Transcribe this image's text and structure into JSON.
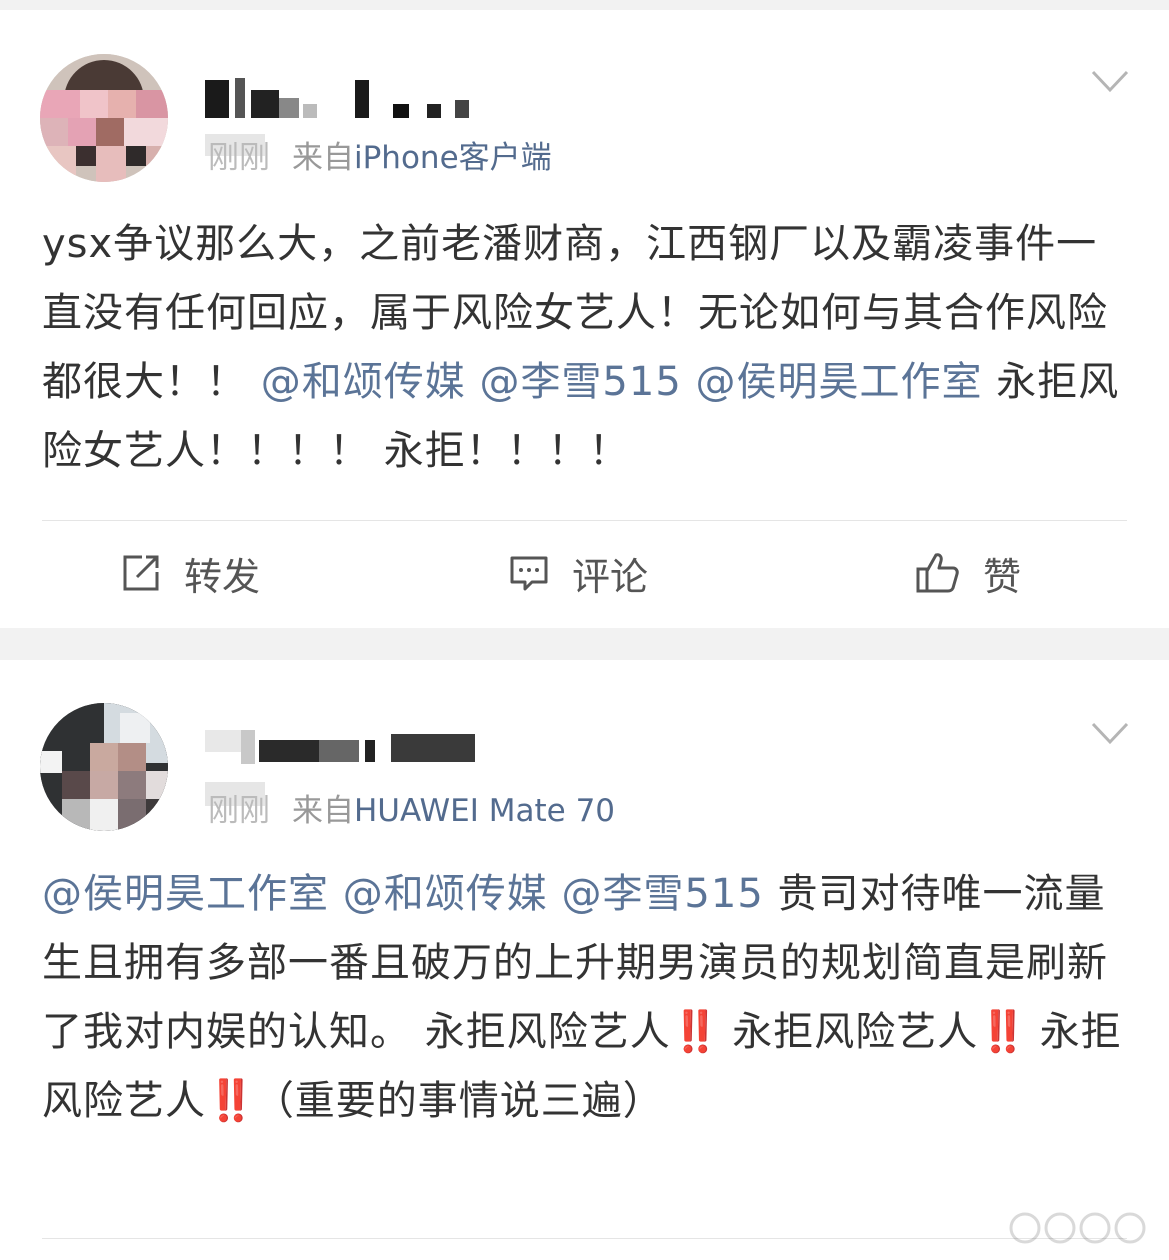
{
  "posts": [
    {
      "username": "",
      "time": "刚刚",
      "source_prefix": "来自",
      "source": "iPhone客户端",
      "content": [
        {
          "type": "text",
          "text": "ysx争议那么大，之前老潘财商，江西钢厂以及霸凌事件一直没有任何回应，属于风险女艺人！无论如何与其合作风险都很大！！ "
        },
        {
          "type": "mention",
          "text": "@和颂传媒"
        },
        {
          "type": "text",
          "text": " "
        },
        {
          "type": "mention",
          "text": "@李雪515"
        },
        {
          "type": "text",
          "text": " "
        },
        {
          "type": "mention",
          "text": "@侯明昊工作室"
        },
        {
          "type": "text",
          "text": " 永拒风险女艺人！！！！ 永拒！！！！"
        }
      ],
      "actions": {
        "repost": "转发",
        "comment": "评论",
        "like": "赞"
      }
    },
    {
      "username": "",
      "time": "刚刚",
      "source_prefix": "来自",
      "source": "HUAWEI Mate 70",
      "content": [
        {
          "type": "mention",
          "text": "@侯明昊工作室"
        },
        {
          "type": "text",
          "text": " "
        },
        {
          "type": "mention",
          "text": "@和颂传媒"
        },
        {
          "type": "text",
          "text": " "
        },
        {
          "type": "mention",
          "text": "@李雪515"
        },
        {
          "type": "text",
          "text": " 贵司对待唯一流量生且拥有多部一番且破万的上升期男演员的规划简直是刷新了我对内娱的认知。 永拒风险艺人"
        },
        {
          "type": "bang",
          "text": "‼️"
        },
        {
          "type": "text",
          "text": " 永拒风险艺人"
        },
        {
          "type": "bang",
          "text": "‼️"
        },
        {
          "type": "text",
          "text": " 永拒风险艺人"
        },
        {
          "type": "bang",
          "text": "‼️"
        },
        {
          "type": "text",
          "text": "（重要的事情说三遍）"
        }
      ]
    }
  ],
  "colors": {
    "mention": "#5b7497",
    "source": "#536b8e",
    "bang": "#e0282e",
    "background": "#f2f2f2"
  },
  "icons": [
    "chevron-down-icon",
    "repost-icon",
    "comment-icon",
    "like-icon"
  ]
}
